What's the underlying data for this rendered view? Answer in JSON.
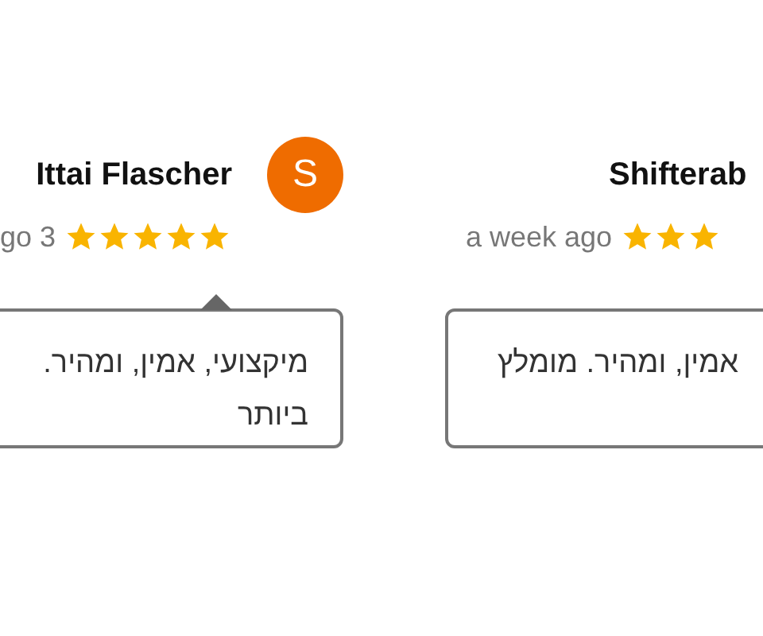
{
  "reviews": [
    {
      "name": "Shifterab",
      "time": "a week ago",
      "stars": 3,
      "selected": false,
      "text_lines": [
        "אמין, ומהיר. מומלץ"
      ]
    },
    {
      "name": "Ittai Flascher",
      "avatar": "S",
      "time": "go 3",
      "stars": 5,
      "selected": true,
      "text_lines": [
        "מיקצועי, אמין, ומהיר.",
        "ביותר"
      ]
    }
  ]
}
